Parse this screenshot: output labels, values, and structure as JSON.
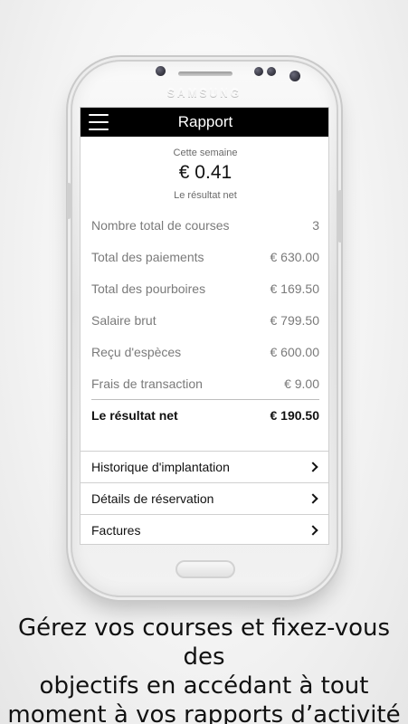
{
  "device": {
    "brand": "SAMSUNG"
  },
  "app": {
    "title": "Rapport",
    "summary": {
      "period": "Cette semaine",
      "amount": "€ 0.41",
      "label": "Le résultat net"
    },
    "rows": [
      {
        "label": "Nombre total de courses",
        "value": "3"
      },
      {
        "label": "Total des paiements",
        "value": "€ 630.00"
      },
      {
        "label": "Total des pourboires",
        "value": "€ 169.50"
      },
      {
        "label": "Salaire brut",
        "value": "€ 799.50"
      },
      {
        "label": "Reçu d'espèces",
        "value": "€ 600.00"
      },
      {
        "label": "Frais de transaction",
        "value": "€ 9.00"
      }
    ],
    "total": {
      "label": "Le résultat net",
      "value": "€ 190.50"
    },
    "links": [
      {
        "label": "Historique d'implantation"
      },
      {
        "label": "Détails de réservation"
      },
      {
        "label": "Factures"
      }
    ]
  },
  "caption": {
    "line1": "Gérez vos courses et fixez-vous des",
    "line2": "objectifs en accédant à tout",
    "line3": "moment à vos rapports d’activité"
  },
  "icons": [
    "hamburger-menu-icon",
    "chevron-right-icon"
  ],
  "colors": {
    "topbar": "#000000",
    "screen": "#ffffff",
    "muted_text": "#7a7a7a"
  }
}
